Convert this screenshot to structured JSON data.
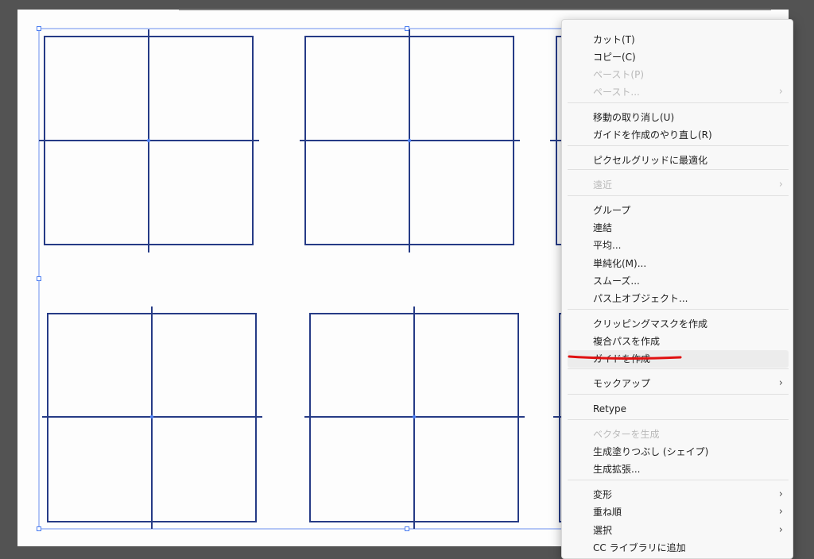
{
  "colors": {
    "workspace": "#535353",
    "artboard": "#fdfdfd",
    "shape_stroke": "#263b86",
    "selection": "#4a7cf0",
    "annotation": "#e01010"
  },
  "context_menu": {
    "items": [
      {
        "label": "カット(T)",
        "disabled": false,
        "submenu": false
      },
      {
        "label": "コピー(C)",
        "disabled": false,
        "submenu": false
      },
      {
        "label": "ペースト(P)",
        "disabled": true,
        "submenu": false
      },
      {
        "label": "ペースト...",
        "disabled": true,
        "submenu": true
      },
      {
        "label": "移動の取り消し(U)",
        "disabled": false,
        "submenu": false
      },
      {
        "label": "ガイドを作成のやり直し(R)",
        "disabled": false,
        "submenu": false
      },
      {
        "label": "ピクセルグリッドに最適化",
        "disabled": false,
        "submenu": false
      },
      {
        "label": "遠近",
        "disabled": true,
        "submenu": true
      },
      {
        "label": "グループ",
        "disabled": false,
        "submenu": false
      },
      {
        "label": "連結",
        "disabled": false,
        "submenu": false
      },
      {
        "label": "平均...",
        "disabled": false,
        "submenu": false
      },
      {
        "label": "単純化(M)...",
        "disabled": false,
        "submenu": false
      },
      {
        "label": "スムーズ...",
        "disabled": false,
        "submenu": false
      },
      {
        "label": "パス上オブジェクト...",
        "disabled": false,
        "submenu": false
      },
      {
        "label": "クリッピングマスクを作成",
        "disabled": false,
        "submenu": false
      },
      {
        "label": "複合パスを作成",
        "disabled": false,
        "submenu": false
      },
      {
        "label": "ガイドを作成",
        "disabled": false,
        "submenu": false,
        "highlighted": true
      },
      {
        "label": "モックアップ",
        "disabled": false,
        "submenu": true
      },
      {
        "label": "Retype",
        "disabled": false,
        "submenu": false
      },
      {
        "label": "ベクターを生成",
        "disabled": true,
        "submenu": false
      },
      {
        "label": "生成塗りつぶし (シェイプ)",
        "disabled": false,
        "submenu": false
      },
      {
        "label": "生成拡張...",
        "disabled": false,
        "submenu": false
      },
      {
        "label": "変形",
        "disabled": false,
        "submenu": true
      },
      {
        "label": "重ね順",
        "disabled": false,
        "submenu": true
      },
      {
        "label": "選択",
        "disabled": false,
        "submenu": true
      },
      {
        "label": "CC ライブラリに追加",
        "disabled": false,
        "submenu": false
      }
    ],
    "submenu_glyph": "›"
  }
}
